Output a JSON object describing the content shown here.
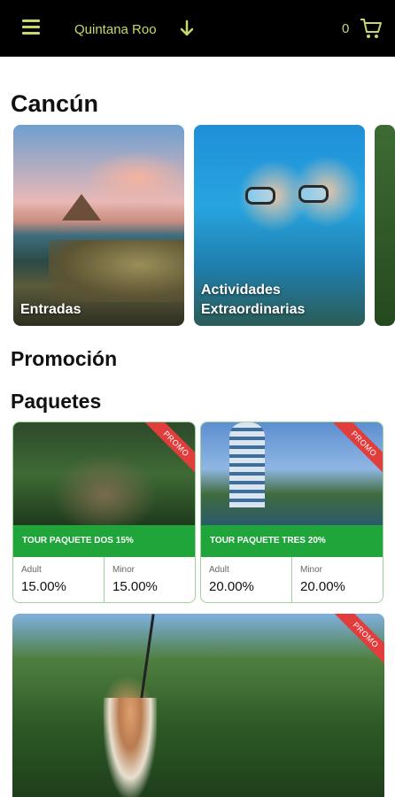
{
  "header": {
    "location": "Quintana Roo",
    "cart_count": "0",
    "icons": {
      "menu": "menu-icon",
      "location_dropdown": "arrow-down-icon",
      "cart": "cart-icon"
    },
    "accent_color": "#c9d66a",
    "background_color": "#000000"
  },
  "city": {
    "title": "Cancún",
    "categories": [
      {
        "label": "Entradas"
      },
      {
        "label": "Actividades Extraordinarias"
      },
      {
        "label": ""
      }
    ]
  },
  "promotion": {
    "title": "Promoción"
  },
  "packages": {
    "title": "Paquetes",
    "badge": "PROMO",
    "badge_color": "#e23d3d",
    "bar_color": "#20a53b",
    "items": [
      {
        "name": "TOUR PAQUETE DOS 15%",
        "adult_label": "Adult",
        "adult_value": "15.00%",
        "minor_label": "Minor",
        "minor_value": "15.00%"
      },
      {
        "name": "TOUR PAQUETE TRES 20%",
        "adult_label": "Adult",
        "adult_value": "20.00%",
        "minor_label": "Minor",
        "minor_value": "20.00%"
      },
      {
        "name": ""
      }
    ]
  }
}
